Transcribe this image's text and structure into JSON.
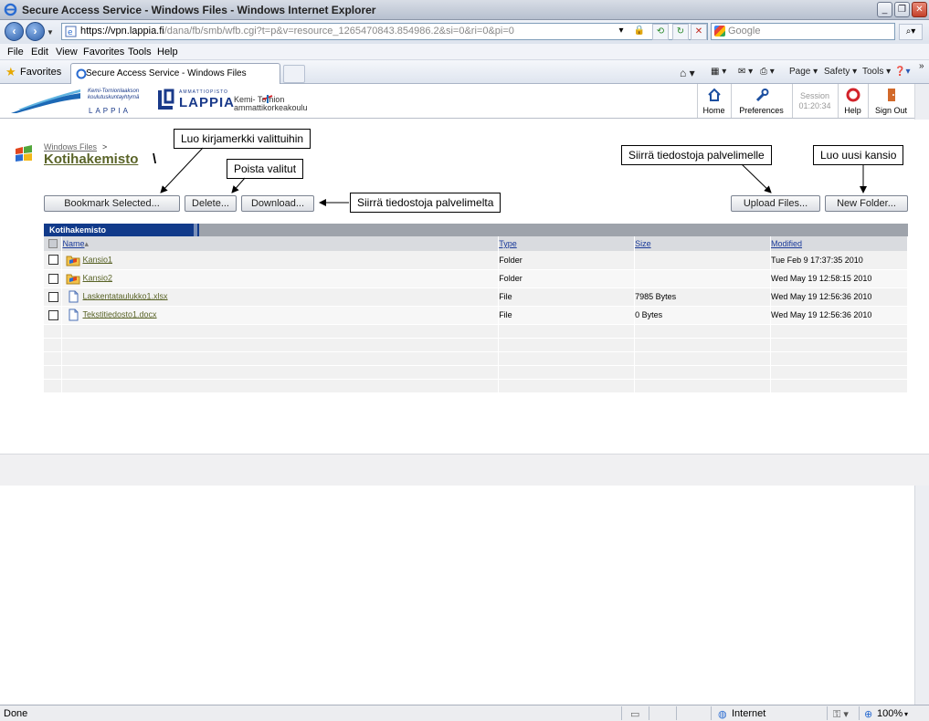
{
  "window": {
    "title": "Secure Access Service - Windows Files - Windows Internet Explorer",
    "minimize": "_",
    "restore": "❐",
    "close": "✕"
  },
  "address": {
    "scheme": "https://",
    "host": "vpn.lappia.fi",
    "path": "/dana/fb/smb/wfb.cgi?t=p&v=resource_1265470843.854986.2&si=0&ri=0&pi=0",
    "search_placeholder": "Google"
  },
  "menu": [
    "File",
    "Edit",
    "View",
    "Favorites",
    "Tools",
    "Help"
  ],
  "favbar": {
    "favorites_label": "Favorites",
    "tab_label": "Secure Access Service - Windows Files",
    "commands": [
      "Page ▾",
      "Safety ▾",
      "Tools ▾"
    ]
  },
  "portal": {
    "logo_small_lines": [
      "Kemi-Tornionlaakson",
      "koulutuskuntayhtymä"
    ],
    "logo_small_name": "LAPPIA",
    "logo_amk": "AMMATTIOPISTO",
    "logo_lappia": "LAPPIA",
    "logo_kemi_line1": "Kemi-    Tornion",
    "logo_kemi_line2": "ammattikorkeakoulu",
    "nav": {
      "home": "Home",
      "preferences": "Preferences",
      "session_label": "Session",
      "session_time": "01:20:34",
      "help": "Help",
      "signout": "Sign Out"
    }
  },
  "breadcrumb": {
    "parent": "Windows Files",
    "sep": ">",
    "title": "Kotihakemisto",
    "title_sep": "\\"
  },
  "buttons": {
    "bookmark": "Bookmark Selected...",
    "delete": "Delete...",
    "download": "Download...",
    "upload": "Upload Files...",
    "new_folder": "New Folder..."
  },
  "callouts": {
    "bookmark": "Luo kirjamerkki valittuihin",
    "delete": "Poista valitut",
    "download": "Siirrä tiedostoja palvelimelta",
    "upload": "Siirrä tiedostoja palvelimelle",
    "new_folder": "Luo uusi kansio"
  },
  "table": {
    "title": "Kotihakemisto",
    "headers": {
      "name": "Name",
      "type": "Type",
      "size": "Size",
      "modified": "Modified"
    },
    "rows": [
      {
        "name": "Kansio1",
        "type": "Folder",
        "size": "",
        "modified": "Tue Feb 9 17:37:35 2010",
        "kind": "folder"
      },
      {
        "name": "Kansio2",
        "type": "Folder",
        "size": "",
        "modified": "Wed May 19 12:58:15 2010",
        "kind": "folder"
      },
      {
        "name": "Laskentataulukko1.xlsx",
        "type": "File",
        "size": "7985 Bytes",
        "modified": "Wed May 19 12:56:36 2010",
        "kind": "file"
      },
      {
        "name": "Tekstitiedosto1.docx",
        "type": "File",
        "size": "0 Bytes",
        "modified": "Wed May 19 12:56:36 2010",
        "kind": "file"
      }
    ]
  },
  "status": {
    "left": "Done",
    "zone": "Internet",
    "zoom": "100%"
  },
  "colors": {
    "accent": "#113a8a",
    "title_link": "#5a6428"
  }
}
